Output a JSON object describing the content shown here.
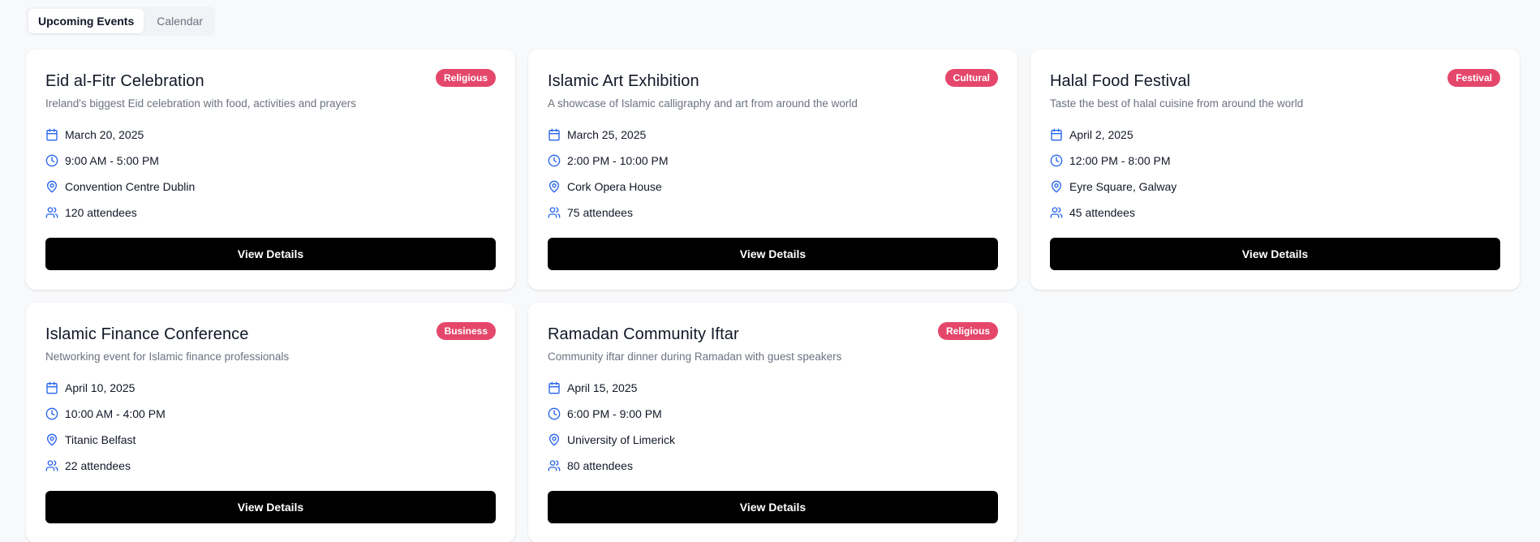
{
  "tabs": [
    {
      "label": "Upcoming Events",
      "active": true
    },
    {
      "label": "Calendar",
      "active": false
    }
  ],
  "colors": {
    "accent_icon": "#2563eb",
    "badge": "#e5476b",
    "button": "#000000"
  },
  "events": [
    {
      "title": "Eid al-Fitr Celebration",
      "badge": "Religious",
      "description": "Ireland's biggest Eid celebration with food, activities and prayers",
      "date": "March 20, 2025",
      "time": "9:00 AM - 5:00 PM",
      "location": "Convention Centre Dublin",
      "attendees": "120 attendees",
      "button": "View Details"
    },
    {
      "title": "Islamic Art Exhibition",
      "badge": "Cultural",
      "description": "A showcase of Islamic calligraphy and art from around the world",
      "date": "March 25, 2025",
      "time": "2:00 PM - 10:00 PM",
      "location": "Cork Opera House",
      "attendees": "75 attendees",
      "button": "View Details"
    },
    {
      "title": "Halal Food Festival",
      "badge": "Festival",
      "description": "Taste the best of halal cuisine from around the world",
      "date": "April 2, 2025",
      "time": "12:00 PM - 8:00 PM",
      "location": "Eyre Square, Galway",
      "attendees": "45 attendees",
      "button": "View Details"
    },
    {
      "title": "Islamic Finance Conference",
      "badge": "Business",
      "description": "Networking event for Islamic finance professionals",
      "date": "April 10, 2025",
      "time": "10:00 AM - 4:00 PM",
      "location": "Titanic Belfast",
      "attendees": "22 attendees",
      "button": "View Details"
    },
    {
      "title": "Ramadan Community Iftar",
      "badge": "Religious",
      "description": "Community iftar dinner during Ramadan with guest speakers",
      "date": "April 15, 2025",
      "time": "6:00 PM - 9:00 PM",
      "location": "University of Limerick",
      "attendees": "80 attendees",
      "button": "View Details"
    }
  ]
}
